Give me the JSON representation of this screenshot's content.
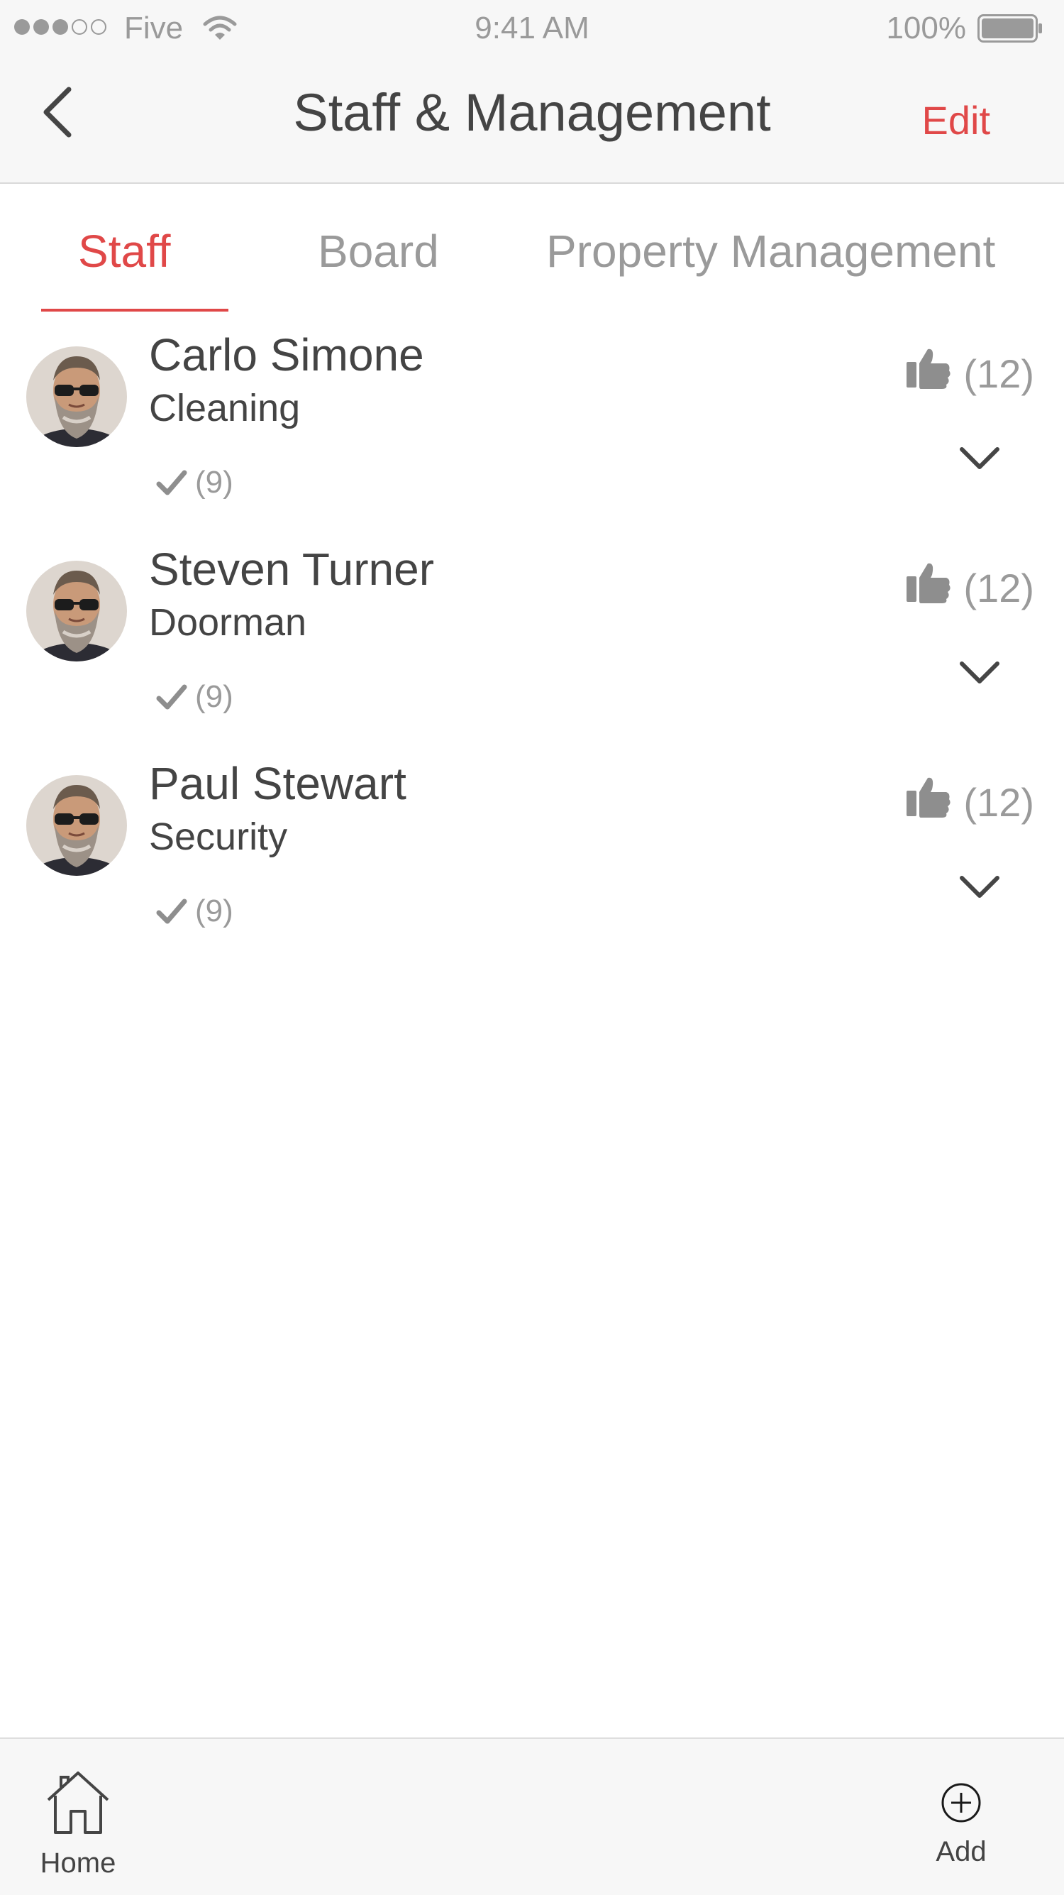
{
  "status_bar": {
    "signal_filled": 3,
    "signal_total": 5,
    "carrier": "Five",
    "time": "9:41 AM",
    "battery_percent": "100%"
  },
  "nav": {
    "title": "Staff & Management",
    "edit_label": "Edit",
    "back_icon": "chevron-left-icon"
  },
  "tabs": [
    {
      "label": "Staff",
      "active": true
    },
    {
      "label": "Board",
      "active": false
    },
    {
      "label": "Property Management",
      "active": false
    }
  ],
  "staff": [
    {
      "name": "Carlo Simone",
      "role": "Cleaning",
      "completed": "(9)",
      "likes": "(12)"
    },
    {
      "name": "Steven Turner",
      "role": "Doorman",
      "completed": "(9)",
      "likes": "(12)"
    },
    {
      "name": "Paul Stewart",
      "role": "Security",
      "completed": "(9)",
      "likes": "(12)"
    }
  ],
  "tab_bar": {
    "home_label": "Home",
    "add_label": "Add"
  },
  "colors": {
    "accent": "#e04848",
    "text": "#444444",
    "muted": "#9a9a9a",
    "bar_background": "#f7f7f7"
  }
}
